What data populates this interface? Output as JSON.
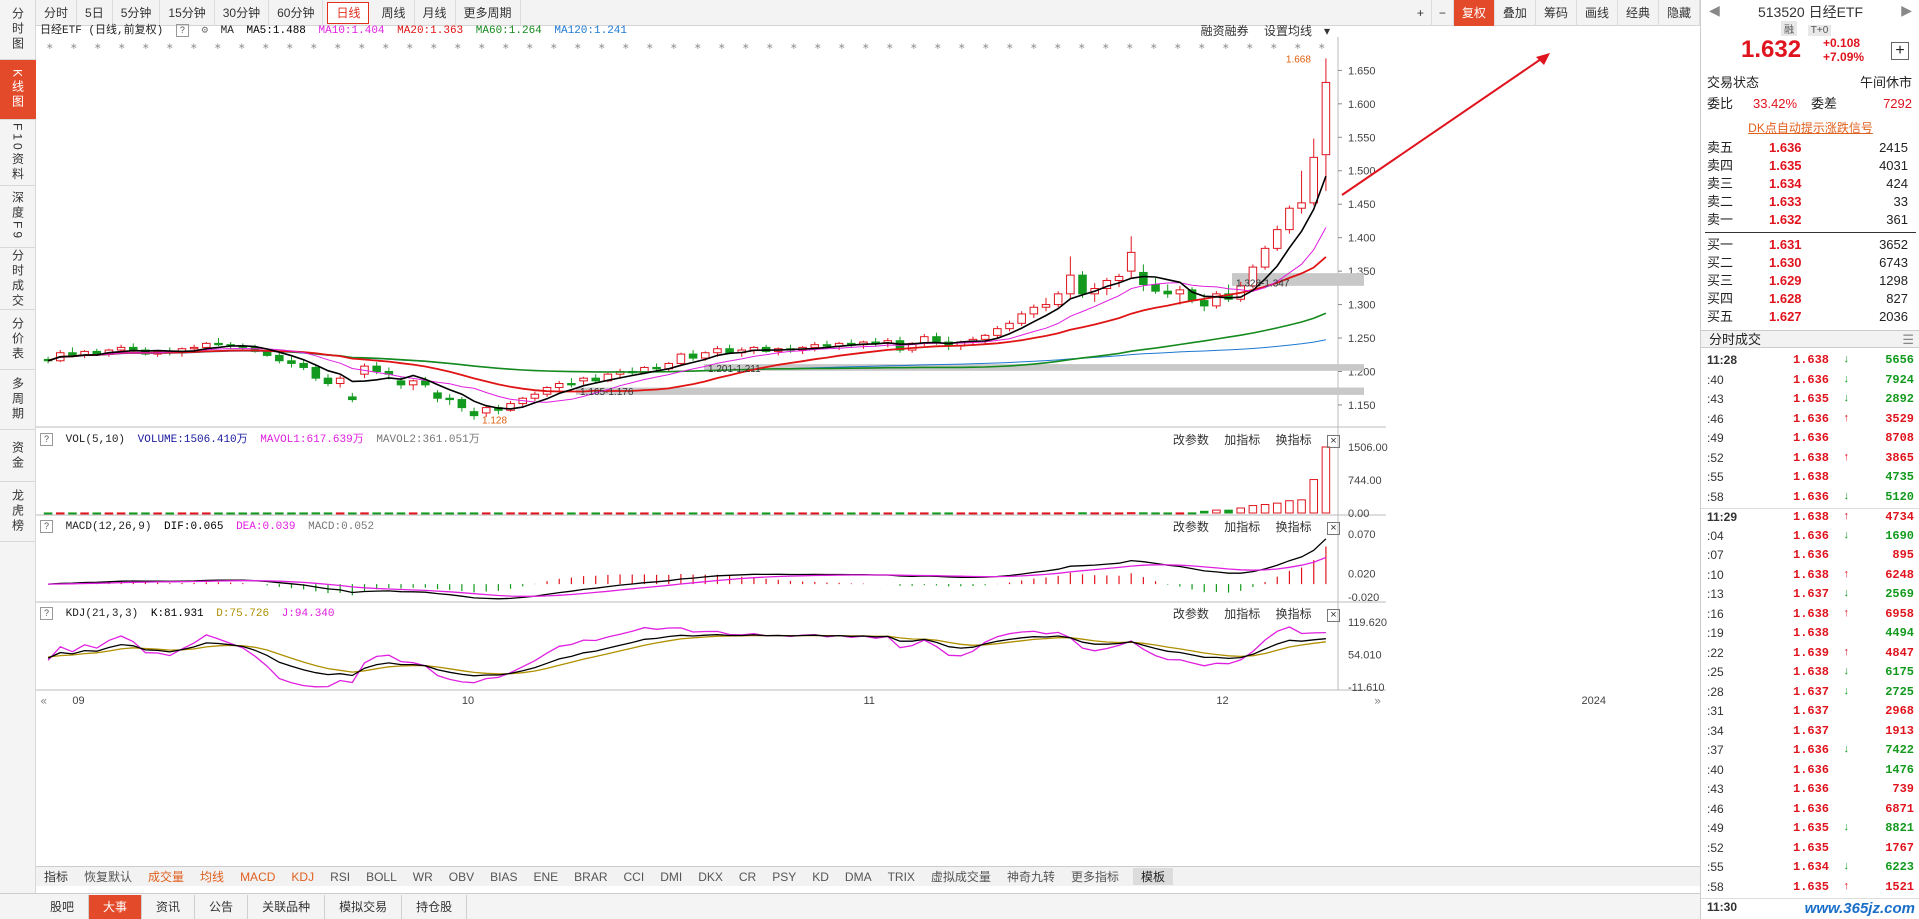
{
  "left_tabs": [
    "分时图",
    "K线图",
    "F10资料",
    "深度F9",
    "分时成交",
    "分价表",
    "多周期",
    "资金",
    "龙虎榜"
  ],
  "left_tab_active": 1,
  "toolbar": {
    "periods": [
      "分时",
      "5日",
      "5分钟",
      "15分钟",
      "30分钟",
      "60分钟",
      "日线",
      "周线",
      "月线",
      "更多周期"
    ],
    "active_period": 6,
    "right_tools": [
      "+",
      "−",
      "复权",
      "叠加",
      "筹码",
      "画线",
      "经典",
      "隐藏"
    ]
  },
  "main_legend": {
    "title": "日经ETF (日线,前复权)",
    "ma_label": "MA",
    "ma5": "MA5:1.488",
    "ma10": "MA10:1.404",
    "ma20": "MA20:1.363",
    "ma60": "MA60:1.264",
    "ma120": "MA120:1.241",
    "right_links": [
      "融资融券",
      "设置均线"
    ],
    "colors": {
      "ma5": "#000000",
      "ma10": "#e020e0",
      "ma20": "#e01414",
      "ma60": "#158a1e",
      "ma120": "#1e78d2"
    }
  },
  "vol_legend": {
    "name": "VOL(5,10)",
    "volume": "VOLUME:1506.410万",
    "mavol1": "MAVOL1:617.639万",
    "mavol2": "MAVOL2:361.051万"
  },
  "macd_legend": {
    "name": "MACD(12,26,9)",
    "dif": "DIF:0.065",
    "dea": "DEA:0.039",
    "macd": "MACD:0.052"
  },
  "kdj_legend": {
    "name": "KDJ(21,3,3)",
    "k": "K:81.931",
    "d": "D:75.726",
    "j": "J:94.340"
  },
  "panel_buttons": [
    "改参数",
    "加指标",
    "换指标"
  ],
  "price_axis": [
    "1.650",
    "1.600",
    "1.550",
    "1.500",
    "1.450",
    "1.400",
    "1.350",
    "1.300",
    "1.250",
    "1.200",
    "1.150"
  ],
  "vol_axis": [
    "1506.00",
    "744.00",
    "0.00"
  ],
  "macd_axis": [
    "0.070",
    "0.020",
    "-0.020"
  ],
  "kdj_axis": [
    "119.620",
    "54.010",
    "-11.610"
  ],
  "date_labels": [
    "09",
    "10",
    "11",
    "12",
    "2024"
  ],
  "annotations": {
    "high": "1.668",
    "low": "1.128",
    "zone1": "1.328-1.347",
    "zone2": "1.201-1.211",
    "zone3": "1.165-1.176"
  },
  "indicator_bar": [
    "指标",
    "恢复默认",
    "成交量",
    "均线",
    "MACD",
    "KDJ",
    "RSI",
    "BOLL",
    "WR",
    "OBV",
    "BIAS",
    "ENE",
    "BRAR",
    "CCI",
    "DMI",
    "DKX",
    "CR",
    "PSY",
    "KD",
    "DMA",
    "TRIX",
    "虚拟成交量",
    "神奇九转",
    "更多指标",
    "模板"
  ],
  "bottom_tabs": [
    "股吧",
    "大事",
    "资讯",
    "公告",
    "关联品种",
    "模拟交易",
    "持仓股"
  ],
  "bottom_active": 1,
  "quote": {
    "code": "513520 日经ETF",
    "badges": [
      "融",
      "T+0"
    ],
    "price": "1.632",
    "change": "+0.108",
    "change_pct": "+7.09%",
    "status_label": "交易状态",
    "status_value": "午间休市",
    "ratio_label": "委比",
    "ratio_value": "33.42%",
    "diff_label": "委差",
    "diff_value": "7292",
    "dk_link": "DK点自动提示涨跌信号"
  },
  "asks": [
    {
      "label": "卖五",
      "price": "1.636",
      "vol": "2415"
    },
    {
      "label": "卖四",
      "price": "1.635",
      "vol": "4031"
    },
    {
      "label": "卖三",
      "price": "1.634",
      "vol": "424"
    },
    {
      "label": "卖二",
      "price": "1.633",
      "vol": "33"
    },
    {
      "label": "卖一",
      "price": "1.632",
      "vol": "361"
    }
  ],
  "bids": [
    {
      "label": "买一",
      "price": "1.631",
      "vol": "3652"
    },
    {
      "label": "买二",
      "price": "1.630",
      "vol": "6743"
    },
    {
      "label": "买三",
      "price": "1.629",
      "vol": "1298"
    },
    {
      "label": "买四",
      "price": "1.628",
      "vol": "827"
    },
    {
      "label": "买五",
      "price": "1.627",
      "vol": "2036"
    }
  ],
  "ticks_title": "分时成交",
  "ticks": [
    {
      "t": "11:28",
      "p": "1.638",
      "a": "↓",
      "v": "5656",
      "c": "green",
      "main": true
    },
    {
      "t": ":40",
      "p": "1.636",
      "a": "↓",
      "v": "7924",
      "c": "green"
    },
    {
      "t": ":43",
      "p": "1.635",
      "a": "↓",
      "v": "2892",
      "c": "green"
    },
    {
      "t": ":46",
      "p": "1.636",
      "a": "↑",
      "v": "3529",
      "c": "red"
    },
    {
      "t": ":49",
      "p": "1.636",
      "a": "",
      "v": "8708",
      "c": "red"
    },
    {
      "t": ":52",
      "p": "1.638",
      "a": "↑",
      "v": "3865",
      "c": "red"
    },
    {
      "t": ":55",
      "p": "1.638",
      "a": "",
      "v": "4735",
      "c": "green"
    },
    {
      "t": ":58",
      "p": "1.636",
      "a": "↓",
      "v": "5120",
      "c": "green"
    },
    {
      "t": "11:29",
      "p": "1.638",
      "a": "↑",
      "v": "4734",
      "c": "red",
      "main": true
    },
    {
      "t": ":04",
      "p": "1.636",
      "a": "↓",
      "v": "1690",
      "c": "green"
    },
    {
      "t": ":07",
      "p": "1.636",
      "a": "",
      "v": "895",
      "c": "red"
    },
    {
      "t": ":10",
      "p": "1.638",
      "a": "↑",
      "v": "6248",
      "c": "red"
    },
    {
      "t": ":13",
      "p": "1.637",
      "a": "↓",
      "v": "2569",
      "c": "green"
    },
    {
      "t": ":16",
      "p": "1.638",
      "a": "↑",
      "v": "6958",
      "c": "red"
    },
    {
      "t": ":19",
      "p": "1.638",
      "a": "",
      "v": "4494",
      "c": "green"
    },
    {
      "t": ":22",
      "p": "1.639",
      "a": "↑",
      "v": "4847",
      "c": "red"
    },
    {
      "t": ":25",
      "p": "1.638",
      "a": "↓",
      "v": "6175",
      "c": "green"
    },
    {
      "t": ":28",
      "p": "1.637",
      "a": "↓",
      "v": "2725",
      "c": "green"
    },
    {
      "t": ":31",
      "p": "1.637",
      "a": "",
      "v": "2968",
      "c": "red"
    },
    {
      "t": ":34",
      "p": "1.637",
      "a": "",
      "v": "1913",
      "c": "red"
    },
    {
      "t": ":37",
      "p": "1.636",
      "a": "↓",
      "v": "7422",
      "c": "green"
    },
    {
      "t": ":40",
      "p": "1.636",
      "a": "",
      "v": "1476",
      "c": "green"
    },
    {
      "t": ":43",
      "p": "1.636",
      "a": "",
      "v": "739",
      "c": "red"
    },
    {
      "t": ":46",
      "p": "1.636",
      "a": "",
      "v": "6871",
      "c": "red"
    },
    {
      "t": ":49",
      "p": "1.635",
      "a": "↓",
      "v": "8821",
      "c": "green"
    },
    {
      "t": ":52",
      "p": "1.635",
      "a": "",
      "v": "1767",
      "c": "red"
    },
    {
      "t": ":55",
      "p": "1.634",
      "a": "↓",
      "v": "6223",
      "c": "green"
    },
    {
      "t": ":58",
      "p": "1.635",
      "a": "↑",
      "v": "1521",
      "c": "red"
    },
    {
      "t": "11:30",
      "p": "",
      "a": "",
      "v": "",
      "c": "red",
      "main": true
    }
  ],
  "watermark": "www.365jz.com",
  "chart_data": {
    "type": "candlestick",
    "price_range": [
      1.12,
      1.67
    ],
    "candles": [
      [
        1.218,
        1.222,
        1.212,
        1.216
      ],
      [
        1.216,
        1.232,
        1.214,
        1.228
      ],
      [
        1.228,
        1.236,
        1.222,
        1.224
      ],
      [
        1.224,
        1.232,
        1.22,
        1.23
      ],
      [
        1.23,
        1.234,
        1.224,
        1.226
      ],
      [
        1.226,
        1.234,
        1.222,
        1.232
      ],
      [
        1.232,
        1.24,
        1.226,
        1.236
      ],
      [
        1.236,
        1.242,
        1.23,
        1.232
      ],
      [
        1.232,
        1.236,
        1.224,
        1.226
      ],
      [
        1.226,
        1.232,
        1.222,
        1.23
      ],
      [
        1.23,
        1.236,
        1.224,
        1.228
      ],
      [
        1.228,
        1.236,
        1.222,
        1.234
      ],
      [
        1.234,
        1.24,
        1.232,
        1.236
      ],
      [
        1.236,
        1.244,
        1.23,
        1.242
      ],
      [
        1.242,
        1.25,
        1.238,
        1.24
      ],
      [
        1.24,
        1.244,
        1.234,
        1.238
      ],
      [
        1.238,
        1.242,
        1.232,
        1.236
      ],
      [
        1.236,
        1.24,
        1.228,
        1.23
      ],
      [
        1.23,
        1.234,
        1.222,
        1.224
      ],
      [
        1.224,
        1.228,
        1.212,
        1.216
      ],
      [
        1.216,
        1.222,
        1.206,
        1.212
      ],
      [
        1.212,
        1.218,
        1.202,
        1.206
      ],
      [
        1.206,
        1.21,
        1.186,
        1.19
      ],
      [
        1.19,
        1.196,
        1.178,
        1.182
      ],
      [
        1.182,
        1.194,
        1.176,
        1.19
      ],
      [
        1.162,
        1.168,
        1.154,
        1.158
      ],
      [
        1.196,
        1.212,
        1.19,
        1.208
      ],
      [
        1.208,
        1.214,
        1.196,
        1.2
      ],
      [
        1.2,
        1.206,
        1.188,
        1.196
      ],
      [
        1.186,
        1.192,
        1.174,
        1.18
      ],
      [
        1.18,
        1.188,
        1.172,
        1.186
      ],
      [
        1.186,
        1.192,
        1.176,
        1.18
      ],
      [
        1.168,
        1.172,
        1.154,
        1.16
      ],
      [
        1.16,
        1.166,
        1.15,
        1.158
      ],
      [
        1.158,
        1.162,
        1.14,
        1.146
      ],
      [
        1.14,
        1.146,
        1.128,
        1.134
      ],
      [
        1.138,
        1.15,
        1.132,
        1.146
      ],
      [
        1.146,
        1.15,
        1.136,
        1.142
      ],
      [
        1.142,
        1.156,
        1.14,
        1.152
      ],
      [
        1.152,
        1.162,
        1.148,
        1.16
      ],
      [
        1.16,
        1.17,
        1.156,
        1.166
      ],
      [
        1.166,
        1.178,
        1.162,
        1.176
      ],
      [
        1.176,
        1.186,
        1.17,
        1.182
      ],
      [
        1.182,
        1.19,
        1.176,
        1.18
      ],
      [
        1.186,
        1.192,
        1.18,
        1.19
      ],
      [
        1.19,
        1.196,
        1.182,
        1.186
      ],
      [
        1.186,
        1.198,
        1.184,
        1.196
      ],
      [
        1.196,
        1.204,
        1.19,
        1.2
      ],
      [
        1.2,
        1.206,
        1.194,
        1.198
      ],
      [
        1.198,
        1.208,
        1.196,
        1.206
      ],
      [
        1.206,
        1.212,
        1.2,
        1.204
      ],
      [
        1.204,
        1.214,
        1.2,
        1.212
      ],
      [
        1.212,
        1.228,
        1.208,
        1.226
      ],
      [
        1.226,
        1.232,
        1.216,
        1.22
      ],
      [
        1.22,
        1.23,
        1.216,
        1.228
      ],
      [
        1.228,
        1.238,
        1.222,
        1.234
      ],
      [
        1.234,
        1.24,
        1.226,
        1.228
      ],
      [
        1.228,
        1.236,
        1.222,
        1.232
      ],
      [
        1.232,
        1.238,
        1.226,
        1.236
      ],
      [
        1.236,
        1.24,
        1.228,
        1.23
      ],
      [
        1.23,
        1.236,
        1.224,
        1.234
      ],
      [
        1.234,
        1.24,
        1.228,
        1.232
      ],
      [
        1.232,
        1.238,
        1.226,
        1.236
      ],
      [
        1.236,
        1.244,
        1.23,
        1.24
      ],
      [
        1.24,
        1.246,
        1.234,
        1.238
      ],
      [
        1.238,
        1.244,
        1.232,
        1.242
      ],
      [
        1.242,
        1.248,
        1.236,
        1.24
      ],
      [
        1.24,
        1.246,
        1.234,
        1.244
      ],
      [
        1.244,
        1.25,
        1.238,
        1.242
      ],
      [
        1.242,
        1.25,
        1.236,
        1.246
      ],
      [
        1.246,
        1.252,
        1.228,
        1.232
      ],
      [
        1.232,
        1.244,
        1.228,
        1.242
      ],
      [
        1.242,
        1.256,
        1.238,
        1.252
      ],
      [
        1.252,
        1.258,
        1.24,
        1.244
      ],
      [
        1.244,
        1.252,
        1.232,
        1.238
      ],
      [
        1.238,
        1.246,
        1.232,
        1.244
      ],
      [
        1.244,
        1.252,
        1.238,
        1.248
      ],
      [
        1.248,
        1.256,
        1.24,
        1.254
      ],
      [
        1.254,
        1.268,
        1.25,
        1.264
      ],
      [
        1.264,
        1.276,
        1.26,
        1.272
      ],
      [
        1.272,
        1.29,
        1.268,
        1.286
      ],
      [
        1.286,
        1.3,
        1.28,
        1.296
      ],
      [
        1.296,
        1.31,
        1.29,
        1.3
      ],
      [
        1.3,
        1.32,
        1.296,
        1.316
      ],
      [
        1.316,
        1.372,
        1.308,
        1.344
      ],
      [
        1.344,
        1.35,
        1.31,
        1.316
      ],
      [
        1.316,
        1.332,
        1.304,
        1.324
      ],
      [
        1.324,
        1.34,
        1.314,
        1.336
      ],
      [
        1.336,
        1.346,
        1.326,
        1.342
      ],
      [
        1.35,
        1.402,
        1.34,
        1.378
      ],
      [
        1.348,
        1.36,
        1.32,
        1.33
      ],
      [
        1.33,
        1.34,
        1.316,
        1.32
      ],
      [
        1.32,
        1.33,
        1.31,
        1.316
      ],
      [
        1.316,
        1.328,
        1.3,
        1.322
      ],
      [
        1.322,
        1.326,
        1.302,
        1.306
      ],
      [
        1.306,
        1.316,
        1.29,
        1.298
      ],
      [
        1.298,
        1.32,
        1.294,
        1.316
      ],
      [
        1.316,
        1.33,
        1.304,
        1.308
      ],
      [
        1.308,
        1.334,
        1.304,
        1.328
      ],
      [
        1.328,
        1.36,
        1.324,
        1.356
      ],
      [
        1.356,
        1.388,
        1.352,
        1.384
      ],
      [
        1.384,
        1.418,
        1.38,
        1.412
      ],
      [
        1.412,
        1.448,
        1.406,
        1.444
      ],
      [
        1.444,
        1.5,
        1.436,
        1.452
      ],
      [
        1.452,
        1.548,
        1.448,
        1.52
      ],
      [
        1.524,
        1.668,
        1.47,
        1.632
      ]
    ]
  }
}
